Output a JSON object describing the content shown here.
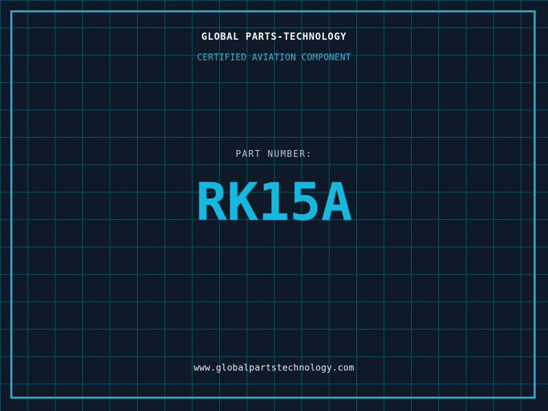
{
  "header": {
    "title": "GLOBAL PARTS-TECHNOLOGY",
    "subtitle": "CERTIFIED AVIATION COMPONENT"
  },
  "part": {
    "label": "PART NUMBER:",
    "number": "RK15A"
  },
  "footer": {
    "website": "www.globalpartstechnology.com"
  },
  "colors": {
    "background": "#0f1a28",
    "grid_line": "#164a60",
    "frame_cyan": "#00b7da",
    "part_number_cyan": "#16b8dd",
    "subtitle_cyan": "#36aecf",
    "label_gray": "#bac3cd",
    "text_white": "#f5f6f7"
  }
}
